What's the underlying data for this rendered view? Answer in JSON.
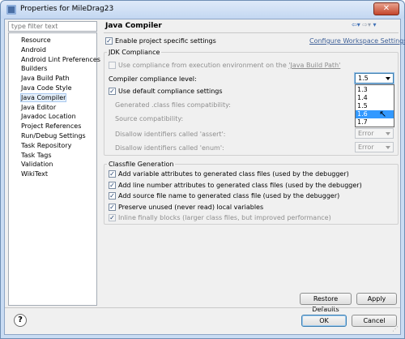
{
  "window": {
    "title": "Properties for MileDrag23",
    "close_glyph": "✕"
  },
  "filter": {
    "placeholder": "type filter text"
  },
  "tree": {
    "items": [
      {
        "label": "Resource",
        "selected": false
      },
      {
        "label": "Android",
        "selected": false
      },
      {
        "label": "Android Lint Preferences",
        "selected": false
      },
      {
        "label": "Builders",
        "selected": false
      },
      {
        "label": "Java Build Path",
        "selected": false
      },
      {
        "label": "Java Code Style",
        "selected": false
      },
      {
        "label": "Java Compiler",
        "selected": true
      },
      {
        "label": "Java Editor",
        "selected": false
      },
      {
        "label": "Javadoc Location",
        "selected": false
      },
      {
        "label": "Project References",
        "selected": false
      },
      {
        "label": "Run/Debug Settings",
        "selected": false
      },
      {
        "label": "Task Repository",
        "selected": false
      },
      {
        "label": "Task Tags",
        "selected": false
      },
      {
        "label": "Validation",
        "selected": false
      },
      {
        "label": "WikiText",
        "selected": false
      }
    ]
  },
  "page": {
    "title": "Java Compiler",
    "nav": {
      "back": "⇦",
      "back_menu": "▾",
      "forward": "⇨",
      "forward_menu": "▾",
      "menu": "▾"
    },
    "enable_specific": {
      "label": "Enable project specific settings",
      "checked": true
    },
    "configure_link": "Configure Workspace Settings..."
  },
  "jdk": {
    "title": "JDK Compliance",
    "use_env_prefix": "Use compliance from execution environment on the ",
    "use_env_link": "'Java Build Path'",
    "use_env_checked": false,
    "compliance_label": "Compiler compliance level:",
    "compliance_value": "1.5",
    "use_defaults": {
      "label": "Use default compliance settings",
      "checked": true
    },
    "generated_label": "Generated .class files compatibility:",
    "source_label": "Source compatibility:",
    "assert_label": "Disallow identifiers called 'assert':",
    "assert_value": "Error",
    "enum_label": "Disallow identifiers called 'enum':",
    "enum_value": "Error"
  },
  "dropdown": {
    "options": [
      "1.3",
      "1.4",
      "1.5",
      "1.6",
      "1.7"
    ],
    "highlighted": "1.6"
  },
  "classfile": {
    "title": "Classfile Generation",
    "options": [
      {
        "label": "Add variable attributes to generated class files (used by the debugger)",
        "checked": true,
        "enabled": true
      },
      {
        "label": "Add line number attributes to generated class files (used by the debugger)",
        "checked": true,
        "enabled": true
      },
      {
        "label": "Add source file name to generated class file (used by the debugger)",
        "checked": true,
        "enabled": true
      },
      {
        "label": "Preserve unused (never read) local variables",
        "checked": true,
        "enabled": true
      },
      {
        "label": "Inline finally blocks (larger class files, but improved performance)",
        "checked": true,
        "enabled": false
      }
    ]
  },
  "buttons": {
    "restore": "Restore Defaults",
    "apply": "Apply",
    "ok": "OK",
    "cancel": "Cancel"
  },
  "help": {
    "glyph": "?"
  },
  "check_glyph": "✓"
}
